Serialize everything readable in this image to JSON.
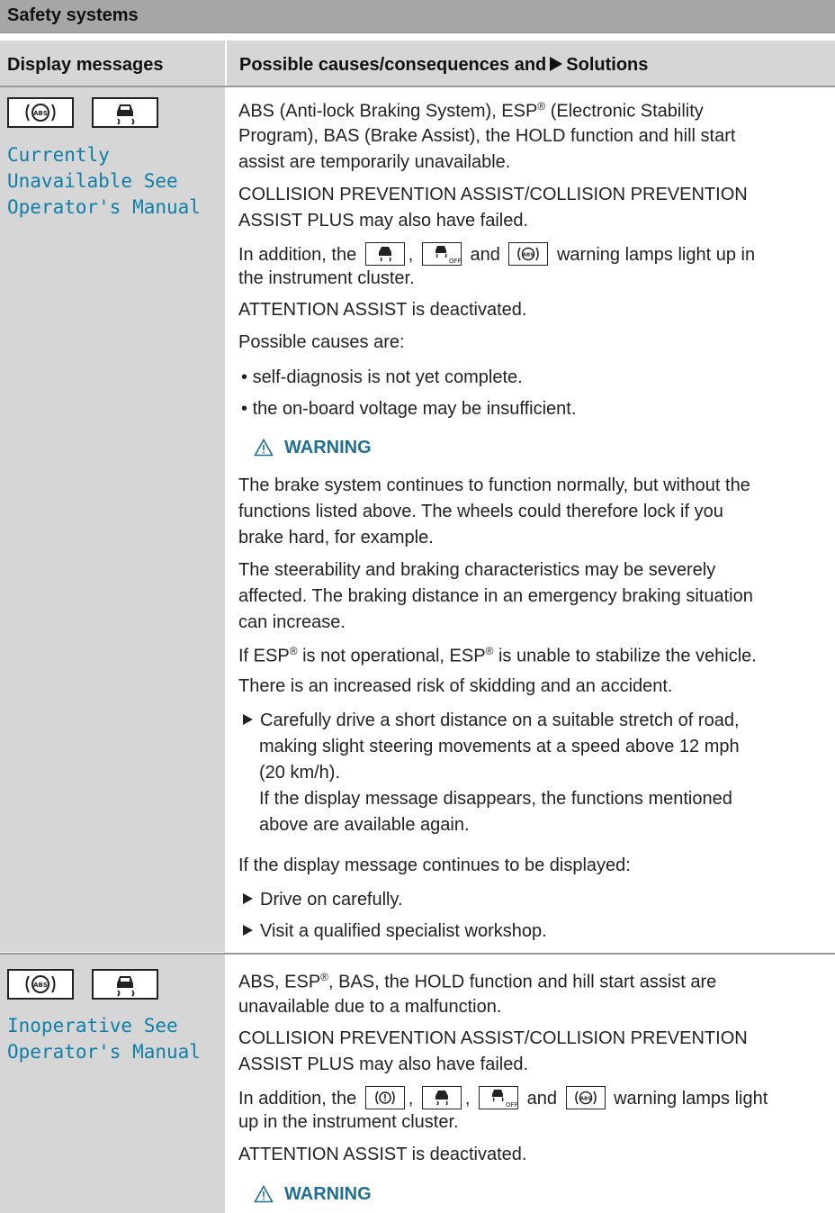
{
  "section_title": "Safety systems",
  "table_header": {
    "col1": "Display messages",
    "col2_prefix": "Possible causes/consequences and",
    "col2_suffix": "Solutions"
  },
  "row1": {
    "message_lines": [
      "Currently",
      "Unavailable See",
      "Operator's Manual"
    ],
    "icons": [
      "abs-icon",
      "skid-car-icon"
    ],
    "lines": [
      "ABS (Anti-lock Braking System), ESP",
      "(Electronic Stability",
      "Program), BAS (Brake Assist), the HOLD function and hill start",
      "assist are temporarily unavailable.",
      "COLLISION PREVENTION ASSIST/COLLISION PREVENTION",
      "ASSIST PLUS may also have failed.",
      "In addition, the",
      ",",
      "and",
      "warning lamps light up in",
      "the instrument cluster.",
      "ATTENTION ASSIST is deactivated.",
      "Possible causes are:"
    ],
    "bullets": [
      "self-diagnosis is not yet complete.",
      "the on-board voltage may be insufficient."
    ],
    "warning_label": "WARNING",
    "warning_lines": [
      "The brake system continues to function normally, but without the",
      "functions listed above. The wheels could therefore lock if you",
      "brake hard, for example.",
      "The steerability and braking characteristics may be severely",
      "affected. The braking distance in an emergency braking situation",
      "can increase.",
      "If ESP",
      "is not operational, ESP",
      "is unable to stabilize the vehicle.",
      "There is an increased risk of skidding and an accident."
    ],
    "action1_lines": [
      "Carefully drive a short distance on a suitable stretch of road,",
      "making slight steering movements at a speed above 12 mph",
      "(20 km/h).",
      "If the display message disappears, the functions mentioned",
      "above are available again."
    ],
    "followup": "If the display message continues to be displayed:",
    "actions": [
      "Drive on carefully.",
      "Visit a qualified specialist workshop."
    ],
    "registered": "®"
  },
  "row2": {
    "message_lines": [
      "Inoperative See",
      "Operator's Manual"
    ],
    "icons": [
      "abs-icon",
      "skid-car-icon"
    ],
    "lines": [
      "ABS, ESP",
      ", BAS, the HOLD function and hill start assist are",
      "unavailable due to a malfunction.",
      "COLLISION PREVENTION ASSIST/COLLISION PREVENTION",
      "ASSIST PLUS may also have failed.",
      "In addition, the",
      ",",
      ",",
      "and",
      "warning lamps light",
      "up in the instrument cluster.",
      "ATTENTION ASSIST is deactivated."
    ],
    "warning_label": "WARNING"
  }
}
